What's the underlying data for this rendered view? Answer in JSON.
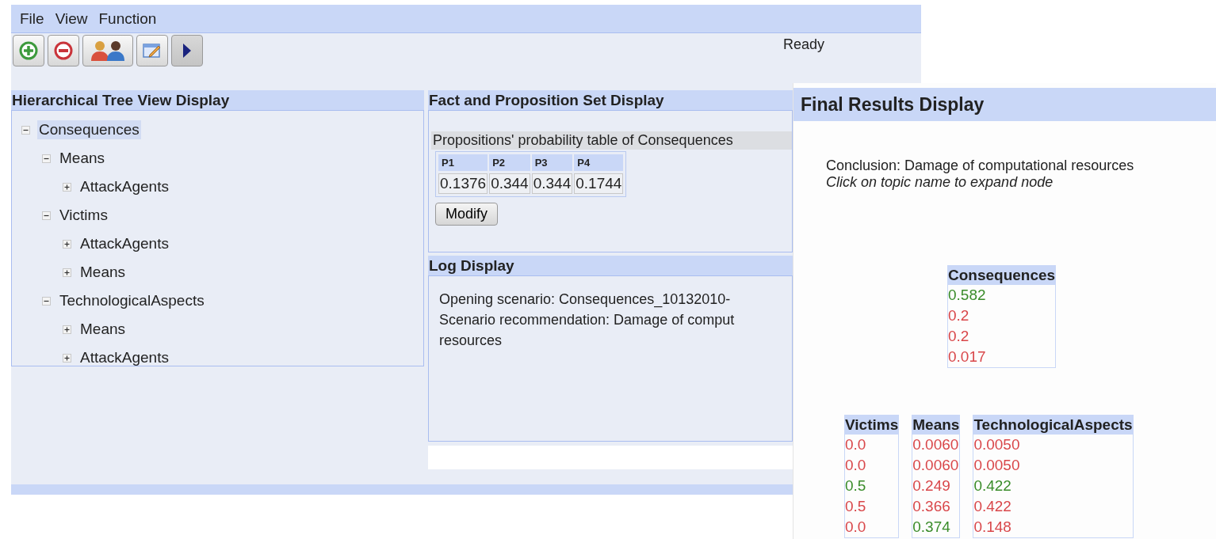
{
  "menu": [
    "File",
    "View",
    "Function"
  ],
  "toolbar": [
    {
      "kind": "add"
    },
    {
      "kind": "remove"
    },
    {
      "kind": "users"
    },
    {
      "kind": "edit"
    },
    {
      "kind": "play"
    }
  ],
  "status": "Ready",
  "tree_panel": {
    "title": "Hierarchical Tree View Display",
    "nodes": [
      {
        "label": "Consequences",
        "expanded": true,
        "selected": true,
        "children": [
          {
            "label": "Means",
            "expanded": true,
            "selected": false,
            "children": [
              {
                "label": "AttackAgents",
                "expanded": false,
                "selected": false
              }
            ]
          },
          {
            "label": "Victims",
            "expanded": true,
            "selected": false,
            "children": [
              {
                "label": "AttackAgents",
                "expanded": false,
                "selected": false
              },
              {
                "label": "Means",
                "expanded": false,
                "selected": false
              }
            ]
          },
          {
            "label": "TechnologicalAspects",
            "expanded": true,
            "selected": false,
            "children": [
              {
                "label": "Means",
                "expanded": false,
                "selected": false
              },
              {
                "label": "AttackAgents",
                "expanded": false,
                "selected": false
              }
            ]
          }
        ]
      }
    ]
  },
  "fact_panel": {
    "title": "Fact and Proposition Set Display",
    "caption": "Propositions' probability table of Consequences",
    "columns": [
      "P1",
      "P2",
      "P3",
      "P4"
    ],
    "values": [
      "0.1376",
      "0.344",
      "0.344",
      "0.1744"
    ],
    "button": "Modify"
  },
  "log_panel": {
    "title": "Log Display",
    "lines": [
      "Opening scenario: Consequences_10132010-",
      "Scenario recommendation: Damage of comput",
      "resources"
    ]
  },
  "results": {
    "title": "Final Results Display",
    "conclusion": "Conclusion: Damage of computational resources",
    "hint": "Click on topic name to expand node",
    "top_table": {
      "title": "Consequences",
      "values": [
        {
          "text": "0.582",
          "color": "#3a8c2a"
        },
        {
          "text": "0.2",
          "color": "#d9474a"
        },
        {
          "text": "0.2",
          "color": "#d9474a"
        },
        {
          "text": "0.017",
          "color": "#d9474a"
        }
      ]
    },
    "tables": [
      {
        "title": "Victims",
        "values": [
          {
            "text": "0.0",
            "color": "#d9474a"
          },
          {
            "text": "0.0",
            "color": "#d9474a"
          },
          {
            "text": "0.5",
            "color": "#3a8c2a"
          },
          {
            "text": "0.5",
            "color": "#d9474a"
          },
          {
            "text": "0.0",
            "color": "#d9474a"
          }
        ]
      },
      {
        "title": "Means",
        "values": [
          {
            "text": "0.0060",
            "color": "#d9474a"
          },
          {
            "text": "0.0060",
            "color": "#d9474a"
          },
          {
            "text": "0.249",
            "color": "#d9474a"
          },
          {
            "text": "0.366",
            "color": "#d9474a"
          },
          {
            "text": "0.374",
            "color": "#3a8c2a"
          }
        ]
      },
      {
        "title": "TechnologicalAspects",
        "values": [
          {
            "text": "0.0050",
            "color": "#d9474a"
          },
          {
            "text": "0.0050",
            "color": "#d9474a"
          },
          {
            "text": "0.422",
            "color": "#3a8c2a"
          },
          {
            "text": "0.422",
            "color": "#d9474a"
          },
          {
            "text": "0.148",
            "color": "#d9474a"
          }
        ]
      }
    ]
  }
}
